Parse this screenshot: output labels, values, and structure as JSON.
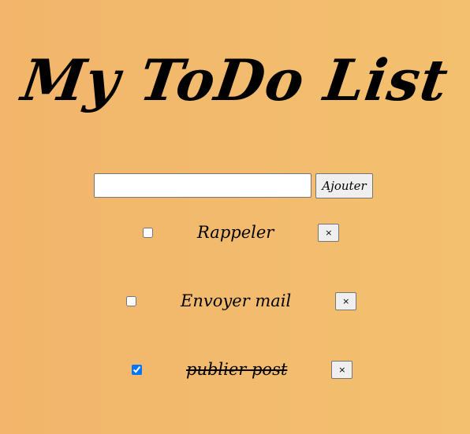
{
  "header": {
    "title": "My ToDo List"
  },
  "form": {
    "input_value": "",
    "input_placeholder": "",
    "add_label": "Ajouter"
  },
  "todos": [
    {
      "label": "Rappeler",
      "checked": false,
      "delete_label": "×"
    },
    {
      "label": "Envoyer mail",
      "checked": false,
      "delete_label": "×"
    },
    {
      "label": "publier post",
      "checked": true,
      "delete_label": "×"
    }
  ],
  "colors": {
    "background_start": "#f2b56b",
    "background_end": "#f3c06f",
    "checkbox_accent": "#0075ff"
  }
}
